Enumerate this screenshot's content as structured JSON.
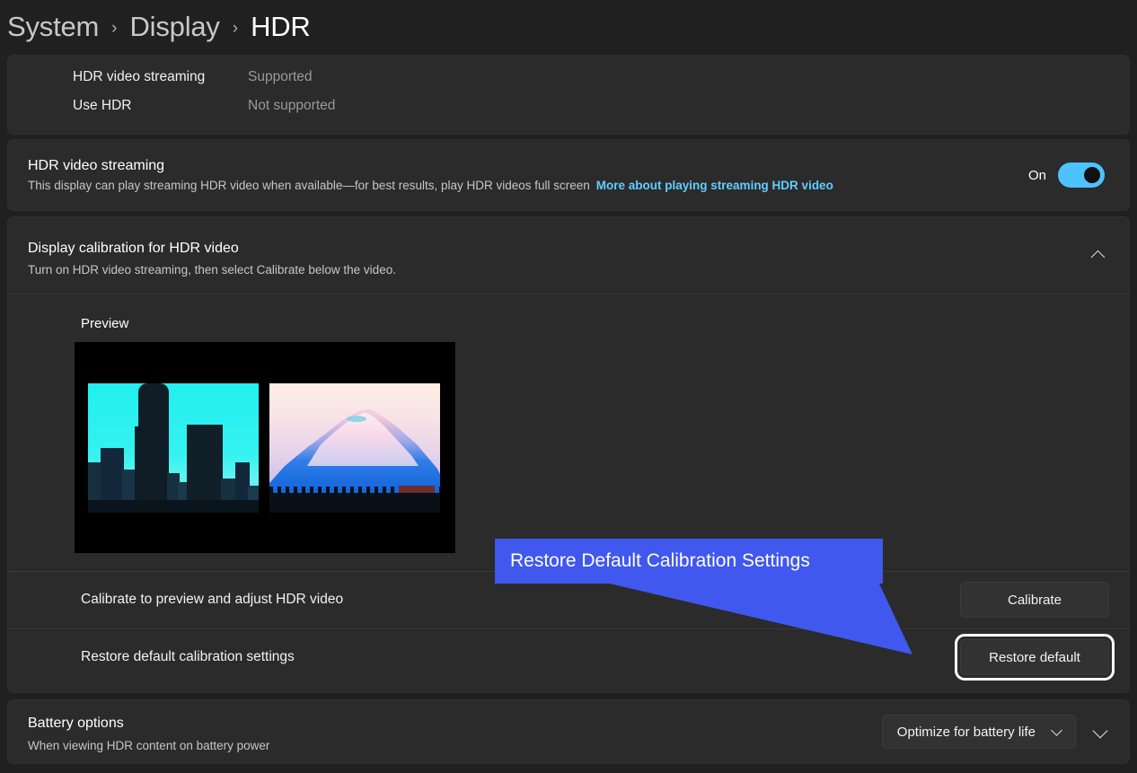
{
  "breadcrumb": {
    "items": [
      {
        "label": "System",
        "current": false
      },
      {
        "label": "Display",
        "current": false
      },
      {
        "label": "HDR",
        "current": true
      }
    ],
    "separator": "›"
  },
  "status_card": {
    "rows": [
      {
        "label": "HDR video streaming",
        "value": "Supported"
      },
      {
        "label": "Use HDR",
        "value": "Not supported"
      }
    ]
  },
  "streaming_card": {
    "title": "HDR video streaming",
    "description": "This display can play streaming HDR video when available—for best results, play HDR videos full screen",
    "link": "More about playing streaming HDR video",
    "toggle_state": "On",
    "toggle_on": true,
    "accent_color": "#4cc2ff",
    "link_color": "#62cdff"
  },
  "calibration_card": {
    "title": "Display calibration for HDR video",
    "subtitle": "Turn on HDR video streaming, then select Calibrate below the video.",
    "collapse_icon": "chevron-up-icon",
    "preview_label": "Preview",
    "preview_images": [
      {
        "name": "seattle-skyline-thumbnail",
        "description": "Seattle city skyline against cyan sky"
      },
      {
        "name": "mount-rainier-thumbnail",
        "description": "Mount Rainier snow peak at dusk"
      }
    ],
    "rows": [
      {
        "label": "Calibrate to preview and adjust HDR video",
        "button": "Calibrate",
        "focused": false
      },
      {
        "label": "Restore default calibration settings",
        "button": "Restore default",
        "focused": true
      }
    ]
  },
  "battery_card": {
    "title": "Battery options",
    "subtitle": "When viewing HDR content on battery power",
    "select_value": "Optimize for battery life",
    "select_icon": "chevron-down-icon",
    "expand_icon": "chevron-down-icon"
  },
  "annotation": {
    "label": "Restore Default Calibration Settings",
    "color": "#4058ee",
    "text_color": "#ffffff"
  }
}
